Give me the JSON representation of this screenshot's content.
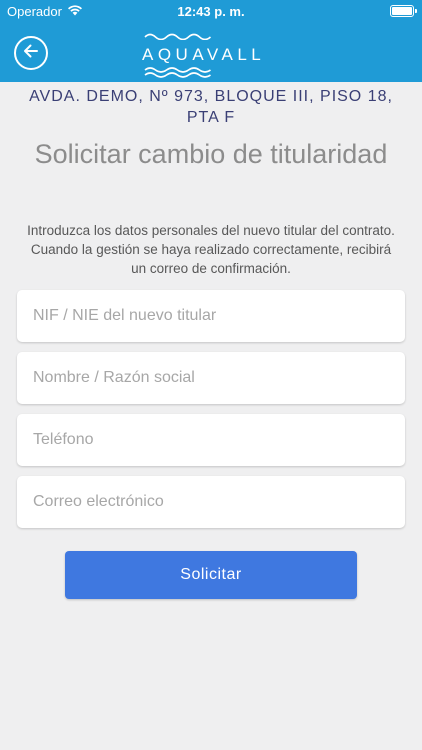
{
  "status_bar": {
    "carrier": "Operador",
    "time": "12:43 p. m.",
    "icons": [
      "wifi-icon",
      "battery-icon"
    ]
  },
  "header": {
    "logo_text": "AQUAVALL",
    "back_icon": "arrow-left-icon",
    "color": "#1f9bd6"
  },
  "content": {
    "address": "AVDA. DEMO, Nº 973, BLOQUE III, PISO 18, PTA F",
    "title": "Solicitar cambio de titularidad",
    "description": "Introduzca los datos personales del nuevo titular del contrato. Cuando la gestión se haya realizado correctamente, recibirá un correo de confirmación."
  },
  "form": {
    "nif_placeholder": "NIF / NIE del nuevo titular",
    "nif_value": "",
    "name_placeholder": "Nombre / Razón social",
    "name_value": "",
    "phone_placeholder": "Teléfono",
    "phone_value": "",
    "email_placeholder": "Correo electrónico",
    "email_value": "",
    "submit_label": "Solicitar",
    "submit_color": "#3f78e0"
  }
}
